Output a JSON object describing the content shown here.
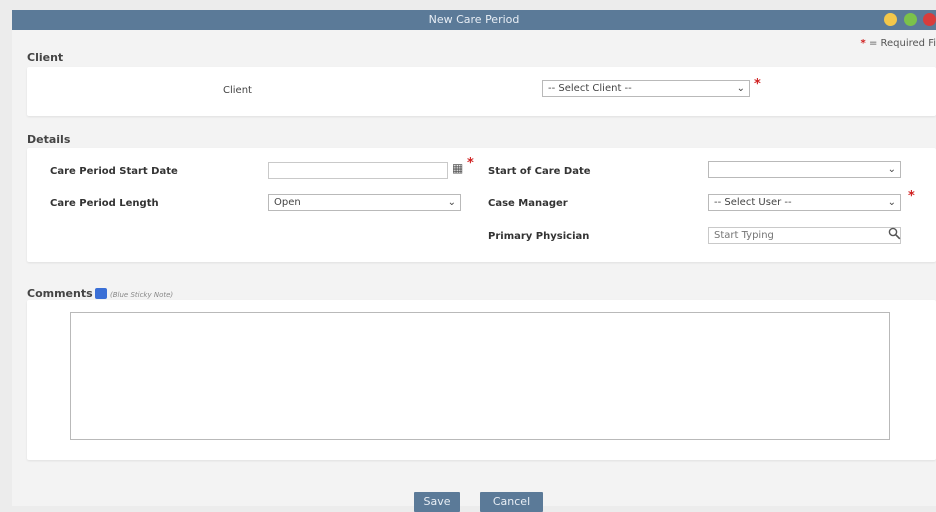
{
  "window": {
    "title": "New Care Period",
    "colors": {
      "titlebar": "#5b7a98",
      "minimize": "#f3c74a",
      "maximize": "#7bc24a",
      "close": "#d83c3c",
      "required": "#d02020"
    }
  },
  "required_note": {
    "star": "*",
    "text": "= Required Fi"
  },
  "client_section": {
    "title": "Client",
    "client_label": "Client",
    "client_select": "-- Select Client --"
  },
  "details_section": {
    "title": "Details",
    "care_start_label": "Care Period Start Date",
    "care_start_value": "",
    "care_length_label": "Care Period Length",
    "care_length_value": "Open",
    "start_of_care_label": "Start of Care Date",
    "start_of_care_value": "",
    "case_manager_label": "Case Manager",
    "case_manager_value": "-- Select User --",
    "physician_label": "Primary Physician",
    "physician_placeholder": "Start Typing"
  },
  "comments_section": {
    "title": "Comments",
    "note_hint": "(Blue Sticky Note)",
    "textarea_value": ""
  },
  "buttons": {
    "save": "Save",
    "cancel": "Cancel"
  },
  "icons": {
    "calendar": "calendar-icon",
    "search": "search-icon",
    "sticky_note": "sticky-note-icon",
    "dropdown": "chevron-down-icon"
  }
}
